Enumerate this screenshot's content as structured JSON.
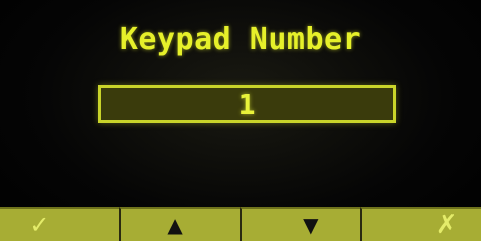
{
  "screen": {
    "title": "Keypad Number",
    "value": "1"
  },
  "softkeys": [
    {
      "icon": "check-icon",
      "glyph": "✓"
    },
    {
      "icon": "up-arrow-icon",
      "glyph": "▲"
    },
    {
      "icon": "down-arrow-icon",
      "glyph": "▼"
    },
    {
      "icon": "cancel-icon",
      "glyph": "✗"
    }
  ],
  "colors": {
    "text": "#e6f02a",
    "softkey_bg": "#a7ad34",
    "value_box_bg": "#3a3b0c"
  }
}
